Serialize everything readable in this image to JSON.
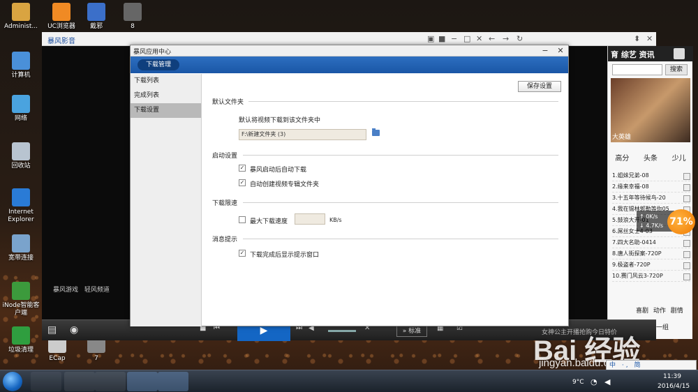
{
  "desktop": {
    "icons": [
      {
        "label": "Administ...",
        "color": "#d9a441"
      },
      {
        "label": "UC浏览器",
        "color": "#f08a24"
      },
      {
        "label": "戴邪",
        "color": "#3b6fc9"
      },
      {
        "label": "8",
        "color": "#666666"
      },
      {
        "label": "计算机",
        "color": "#4a90d9"
      },
      {
        "label": "网络",
        "color": "#4aa3df"
      },
      {
        "label": "回收站",
        "color": "#b8c4d0"
      },
      {
        "label": "Internet Explorer",
        "color": "#2a7bd6"
      },
      {
        "label": "宽带连接",
        "color": "#7aa3cc"
      },
      {
        "label": "iNode智能客户端",
        "color": "#3c9a3c"
      },
      {
        "label": "垃圾清理",
        "color": "#2f9e3f"
      },
      {
        "label": "ECap",
        "color": "#cccccc"
      },
      {
        "label": "7",
        "color": "#888888"
      }
    ]
  },
  "player": {
    "logo": "暴风影音",
    "bottom_links": "暴风游戏  轻风频道",
    "standard_label": "标准",
    "ad_text": "女神公主开播抢购今日特价",
    "sidebar": {
      "nav": "育 综艺 资讯",
      "search_button": "搜索",
      "banner_caption": "大英雄",
      "tabs": [
        "高分",
        "头条",
        "少儿"
      ],
      "list": [
        "1.姐妹兄弟-08",
        "2.缘来幸福-08",
        "3.十五年等待候鸟-20",
        "4.我在锡林郭勒等你05",
        "5.鼓浪大开-01",
        "6.屌丝女士4-03",
        "7.四大名助-0414",
        "8.唐人街探案-720P",
        "9.极盗者-720P",
        "10.赛门风云3-720P"
      ],
      "tags": "喜剧 动作 剧情",
      "more": "换一组"
    }
  },
  "dialog": {
    "title": "暴风应用中心",
    "header_tab": "下载管理",
    "nav": [
      "下载列表",
      "完成列表",
      "下载设置"
    ],
    "active_nav": 2,
    "save_button": "保存设置",
    "sections": {
      "default_folder": "默认文件夹",
      "startup": "启动设置",
      "limit": "下载限速",
      "notify": "消息提示"
    },
    "default_folder_desc": "默认将视频下载到该文件夹中",
    "default_folder_path": "F:\\新建文件夹 (3)",
    "options": {
      "auto_download": {
        "label": "暴风启动后自动下载",
        "checked": true
      },
      "auto_create_folder": {
        "label": "自动创建视频专辑文件夹",
        "checked": true
      },
      "max_speed": {
        "label": "最大下载速度",
        "checked": false
      },
      "notify_complete": {
        "label": "下载完成后显示提示窗口",
        "checked": true
      }
    },
    "speed_unit": "KB/s",
    "speed_value": ""
  },
  "overlay": {
    "upload_speed": "0K/s",
    "download_speed": "4.7K/s",
    "percent": "71%",
    "watermark": "Bai 经验",
    "watermark_url": "jingyan.baidu.com",
    "ime": "中 ·, 简"
  },
  "taskbar": {
    "temperature": "9°C",
    "time": "11:39",
    "date": "2016/4/15"
  }
}
